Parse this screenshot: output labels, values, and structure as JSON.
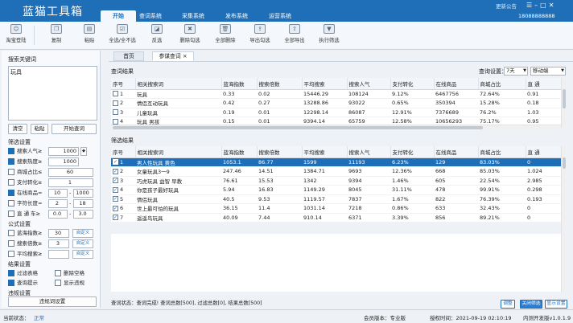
{
  "app": {
    "title": "蓝猫工具箱",
    "update_notice": "更新公告",
    "user": "18088888888"
  },
  "menu_tabs": [
    "开始",
    "查词系统",
    "采集系统",
    "发布系统",
    "运营系统"
  ],
  "toolbar": [
    "淘宝登陆",
    "复制",
    "粘贴",
    "全选/全不选",
    "反选",
    "删除勾选",
    "全部删除",
    "导出勾选",
    "全部导出",
    "执行筛选"
  ],
  "left": {
    "kw_label": "搜索关键词",
    "kw_value": "玩具",
    "btn_clear": "清空",
    "btn_paste": "粘贴",
    "btn_start": "开始查词",
    "filter_title": "筛选设置",
    "filters": [
      {
        "label": "搜索人气≥",
        "min": "1000",
        "max": "",
        "on": true
      },
      {
        "label": "搜索热度≥",
        "min": "1000",
        "max": "",
        "on": true
      },
      {
        "label": "商城占比≤",
        "min": "60",
        "max": "",
        "on": false
      },
      {
        "label": "支付转化≥",
        "min": "1",
        "max": "",
        "on": false
      },
      {
        "label": "在线商品=",
        "min": "10",
        "max": "1000",
        "on": true
      },
      {
        "label": "字符长度=",
        "min": "2",
        "max": "18",
        "on": false
      },
      {
        "label": "直 通 车≥",
        "min": "0.0",
        "max": "3.0",
        "on": false
      }
    ],
    "formula_title": "公式设置",
    "formulas": [
      {
        "label": "蓝海指数≥",
        "value": "30",
        "btn": "自定义"
      },
      {
        "label": "搜索倍数≥",
        "value": "3",
        "btn": "自定义"
      },
      {
        "label": "平均搜索≥",
        "value": "",
        "btn": "自定义"
      }
    ],
    "result_title": "结果设置",
    "results": [
      {
        "label": "过滤表格",
        "on": true
      },
      {
        "label": "删除空格",
        "on": false
      },
      {
        "label": "查询提示",
        "on": true
      },
      {
        "label": "显示违规",
        "on": false
      }
    ],
    "violation_title": "违规设置",
    "violation_btn": "违规词设置"
  },
  "page_tabs": [
    "首页",
    "参谋查词"
  ],
  "top": {
    "title": "查词结果",
    "query_label": "查询设置：",
    "range": "7天",
    "device": "移动端",
    "columns": [
      "序号",
      "相关搜索词",
      "蓝海指数",
      "搜索倍数",
      "平均搜索",
      "搜索人气",
      "支付转化",
      "在线商品",
      "商城占比",
      "直 通"
    ],
    "rows": [
      [
        "1",
        "玩具",
        "0.33",
        "0.02",
        "15446.29",
        "108124",
        "9.12%",
        "6467756",
        "72.64%",
        "0.91"
      ],
      [
        "2",
        "情侣互动玩具",
        "0.42",
        "0.27",
        "13288.86",
        "93022",
        "0.65%",
        "350394",
        "15.28%",
        "0.18"
      ],
      [
        "3",
        "儿童玩具",
        "0.19",
        "0.01",
        "12298.14",
        "86087",
        "12.91%",
        "7376689",
        "76.2%",
        "1.03"
      ],
      [
        "4",
        "玩具 男孩",
        "0.15",
        "0.01",
        "9394.14",
        "65759",
        "12.58%",
        "10656293",
        "75.17%",
        "0.95"
      ]
    ]
  },
  "bottom": {
    "title": "筛选结果",
    "columns": [
      "序号",
      "相关搜索词",
      "蓝海指数",
      "搜索倍数",
      "平均搜索",
      "搜索人气",
      "支付转化",
      "在线商品",
      "商城占比",
      "直 通"
    ],
    "rows": [
      [
        "1",
        "男人性玩具 黄色",
        "1053.1",
        "86.77",
        "1599",
        "11193",
        "6.23%",
        "129",
        "83.03%",
        "0"
      ],
      [
        "2",
        "女童玩具3一9",
        "247.46",
        "14.51",
        "1384.71",
        "9693",
        "12.36%",
        "668",
        "85.03%",
        "1.024"
      ],
      [
        "3",
        "巧虎玩具 益智 早教",
        "76.61",
        "15.53",
        "1342",
        "9394",
        "1.46%",
        "605",
        "22.54%",
        "2.985"
      ],
      [
        "4",
        "你是孩子最好玩具",
        "5.94",
        "16.83",
        "1149.29",
        "8045",
        "31.11%",
        "478",
        "99.91%",
        "0.298"
      ],
      [
        "5",
        "情侣玩具",
        "40.5",
        "9.53",
        "1119.57",
        "7837",
        "1.67%",
        "822",
        "76.39%",
        "0.193"
      ],
      [
        "6",
        "世上最可怕的玩具",
        "36.15",
        "11.4",
        "1031.14",
        "7218",
        "0.86%",
        "633",
        "32.43%",
        "0"
      ],
      [
        "7",
        "遥遥鸟玩具",
        "40.09",
        "7.44",
        "910.14",
        "6371",
        "3.39%",
        "856",
        "89.21%",
        "0"
      ]
    ]
  },
  "main_status": "查词状态：查词完成! 查词总数[500], 过滤总数[0], 结果总数[500]",
  "bottom_buttons": [
    "调整",
    "关闭筛选",
    "显示设置"
  ],
  "status": {
    "state_label": "当前状态：",
    "state": "正常",
    "member": "会员版本：专业版",
    "license": "授权时间：2021-09-19 02:10:19",
    "version": "内测开发版v1.0.1.9"
  }
}
